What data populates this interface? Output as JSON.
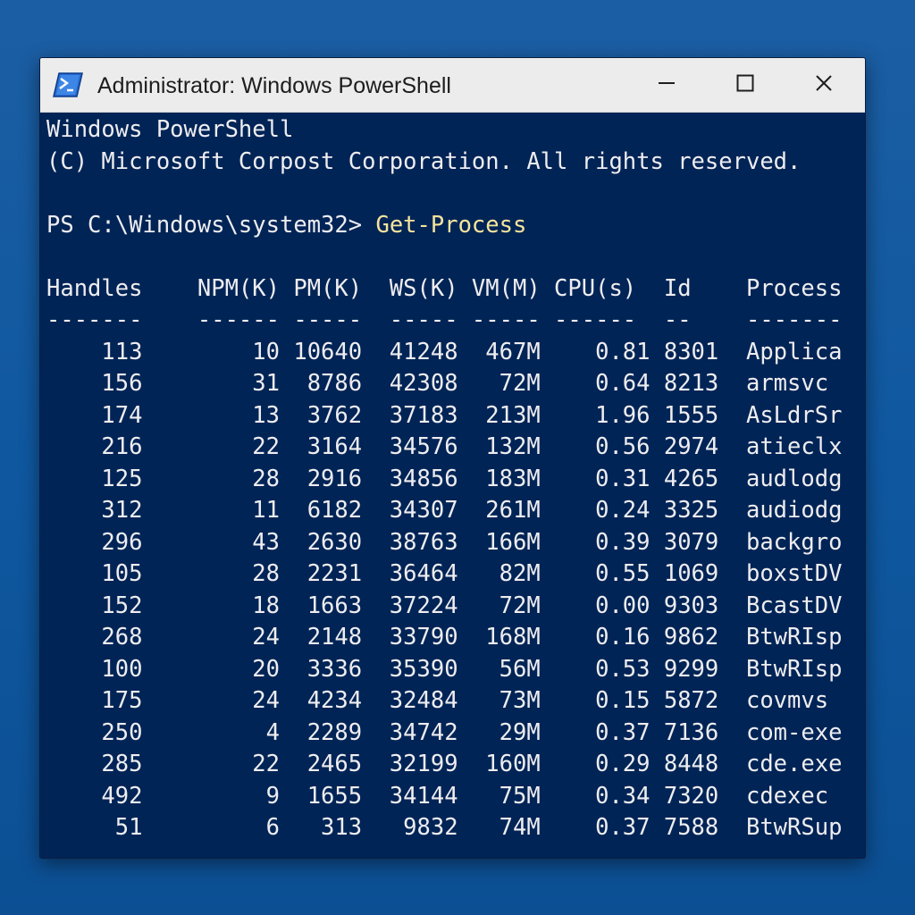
{
  "window": {
    "title": "Administrator: Windows PowerShell",
    "icon": "powershell-icon",
    "controls": {
      "minimize": "minimize-icon",
      "maximize": "maximize-icon",
      "close": "close-icon"
    }
  },
  "console": {
    "banner": [
      "Windows PowerShell",
      "(C) Microsoft Corpost Corporation. All rights reserved."
    ],
    "prompt": "PS C:\\Windows\\system32> ",
    "command": "Get-Process",
    "header": "Handles    NPM(K) PM(K)  WS(K) VM(M) CPU(s)  Id    Process",
    "separator": "-------    ------ -----  ----- ----- ------  --    -------",
    "rows": [
      "    113        10 10640  41248  467M    0.81 8301  Applica",
      "    156        31  8786  42308   72M    0.64 8213  armsvc",
      "    174        13  3762  37183  213M    1.96 1555  AsLdrSr",
      "    216        22  3164  34576  132M    0.56 2974  atieclx",
      "    125        28  2916  34856  183M    0.31 4265  audlodg",
      "    312        11  6182  34307  261M    0.24 3325  audiodg",
      "    296        43  2630  38763  166M    0.39 3079  backgro",
      "    105        28  2231  36464   82M    0.55 1069  boxstDV",
      "    152        18  1663  37224   72M    0.00 9303  BcastDV",
      "    268        24  2148  33790  168M    0.16 9862  BtwRIsp",
      "    100        20  3336  35390   56M    0.53 9299  BtwRIsp",
      "    175        24  4234  32484   73M    0.15 5872  covmvs",
      "    250         4  2289  34742   29M    0.37 7136  com-exe",
      "    285        22  2465  32199  160M    0.29 8448  cde.exe",
      "    492         9  1655  34144   75M    0.34 7320  cdexec",
      "     51         6   313   9832   74M    0.37 7588  BtwRSup"
    ]
  },
  "colors": {
    "console_bg": "#012456",
    "text": "#eeedf0",
    "command": "#f5e49c",
    "desktop": "#1c5ea3"
  }
}
